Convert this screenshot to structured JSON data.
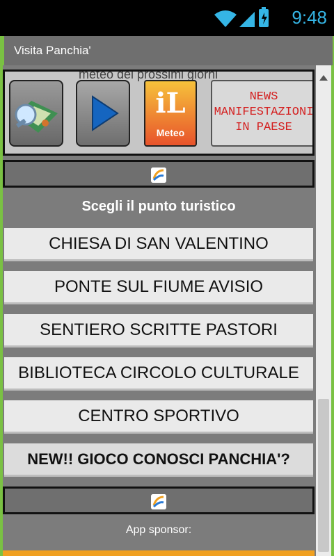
{
  "status_bar": {
    "time": "9:48",
    "icons": [
      "wifi-icon",
      "signal-icon",
      "battery-icon"
    ]
  },
  "app": {
    "title": "Visita Panchia'"
  },
  "toolbar": {
    "background_text": [
      "meteo dei prossimi giorni"
    ],
    "buttons": [
      {
        "name": "map-button",
        "icon": "map-icon"
      },
      {
        "name": "play-button",
        "icon": "play-icon"
      },
      {
        "name": "meteo-button",
        "icon": "meteo-icon",
        "label": "Meteo",
        "logo_text": "iL"
      }
    ],
    "news": {
      "line1": "NEWS",
      "line2": "MANIFESTAZIONI",
      "line3": "IN PAESE"
    }
  },
  "sponsor_logo": "logo-icon",
  "heading": "Scegli il punto turistico",
  "poi": [
    "CHIESA DI SAN VALENTINO",
    "PONTE SUL FIUME AVISIO",
    "SENTIERO SCRITTE PASTORI",
    "BIBLIOTECA CIRCOLO CULTURALE",
    "CENTRO SPORTIVO",
    "NEW!! GIOCO CONOSCI PANCHIA'?"
  ],
  "footer": {
    "sponsor_label": "App sponsor:"
  },
  "colors": {
    "accent": "#7ac143",
    "news_text": "#d41f1f",
    "status_time": "#35b5e5"
  }
}
